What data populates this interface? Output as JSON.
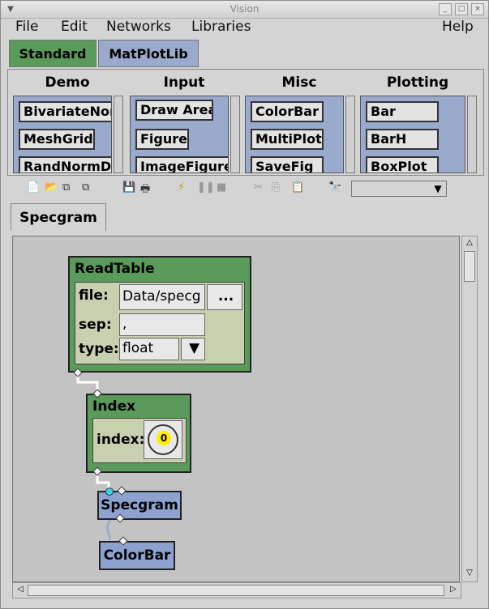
{
  "window": {
    "title": "Vision"
  },
  "menu": {
    "file": "File",
    "edit": "Edit",
    "networks": "Networks",
    "libraries": "Libraries",
    "help": "Help"
  },
  "library_tabs": [
    {
      "label": "Standard"
    },
    {
      "label": "MatPlotLib"
    }
  ],
  "categories": [
    {
      "title": "Demo",
      "modules": [
        "BivariateNor",
        "MeshGrid",
        "RandNormDi"
      ]
    },
    {
      "title": "Input",
      "modules": [
        "Draw Area",
        "Figure",
        "ImageFigure"
      ]
    },
    {
      "title": "Misc",
      "modules": [
        "ColorBar",
        "MultiPlot",
        "SaveFig"
      ]
    },
    {
      "title": "Plotting",
      "modules": [
        "Bar",
        "BarH",
        "BoxPlot"
      ]
    }
  ],
  "network_tab": {
    "label": "Specgram"
  },
  "nodes": {
    "readtable": {
      "title": "ReadTable",
      "file_label": "file:",
      "file_value": "Data/specg",
      "browse_label": "...",
      "sep_label": "sep:",
      "sep_value": ",",
      "type_label": "type:",
      "type_value": "float"
    },
    "index": {
      "title": "Index",
      "index_label": "index:",
      "dial_value": "0"
    },
    "specgram": {
      "title": "Specgram"
    },
    "colorbar": {
      "title": "ColorBar"
    }
  },
  "colors": {
    "standard_tab": "#5a9a5a",
    "matplotlib_tab": "#9aaacc",
    "node_green": "#5a9a5a",
    "node_blue": "#8ea2d0",
    "canvas": "#c3c3c3"
  }
}
